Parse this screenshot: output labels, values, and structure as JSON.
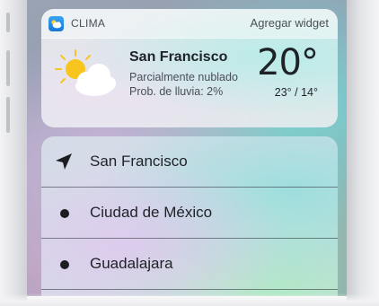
{
  "widget": {
    "app_name": "CLIMA",
    "add_widget": "Agregar widget",
    "city": "San Francisco",
    "condition": "Parcialmente nublado",
    "rain_chance": "Prob. de lluvia: 2%",
    "temperature": "20°",
    "hi_lo": "23° / 14°",
    "weather_icon": "partly-cloudy-icon"
  },
  "locations": [
    {
      "label": "San Francisco",
      "icon": "location-arrow-icon"
    },
    {
      "label": "Ciudad de México",
      "icon": "dot-icon"
    },
    {
      "label": "Guadalajara",
      "icon": "dot-icon"
    }
  ],
  "colors": {
    "app_icon": "#1677d8",
    "sun": "#f7c51e",
    "text_primary": "#1f2227",
    "text_secondary": "#4a4f57"
  }
}
